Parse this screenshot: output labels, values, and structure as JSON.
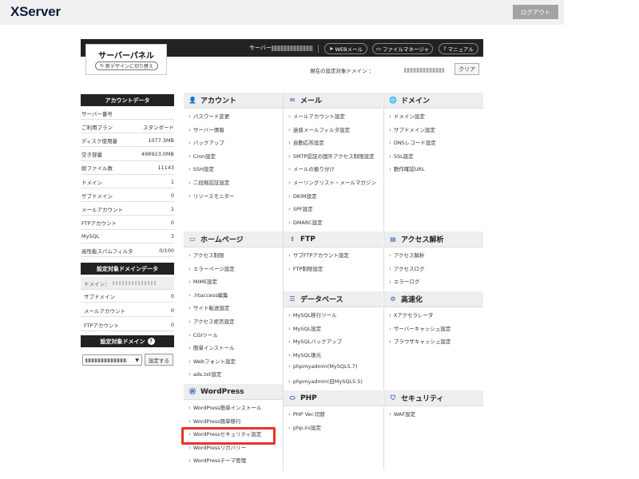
{
  "app": {
    "logo": "XServer",
    "logout": "ログアウト"
  },
  "panel": {
    "title": "サーバーパネル",
    "switch": "新デザインに切り替え"
  },
  "header": {
    "server_id_label": "サーバーID :",
    "webmail": "WEBメール",
    "filemanager": "ファイルマネージャ",
    "manual": "マニュアル",
    "current_domain": "現在の設定対象ドメイン ：",
    "clear": "クリア"
  },
  "account": {
    "title": "アカウントデータ",
    "rows": [
      {
        "label": "サーバー番号",
        "value": ""
      },
      {
        "label": "ご利用プラン",
        "value": "スタンダード"
      },
      {
        "label": "ディスク使用量",
        "value": "1077.3MB"
      },
      {
        "label": "空き容量",
        "value": "498923.0MB"
      },
      {
        "label": "総ファイル数",
        "value": "11143"
      },
      {
        "label": "ドメイン",
        "value": "1"
      },
      {
        "label": "サブドメイン",
        "value": "0"
      },
      {
        "label": "メールアカウント",
        "value": "1"
      },
      {
        "label": "FTPアカウント",
        "value": "0"
      },
      {
        "label": "MySQL",
        "value": "3"
      },
      {
        "label": "高性能スパムフィルタ",
        "value": "0/100"
      }
    ]
  },
  "domain_data": {
    "title": "設定対象ドメインデータ",
    "domain_label": "ドメイン：",
    "rows": [
      {
        "label": "サブドメイン",
        "value": "0"
      },
      {
        "label": "メールアカウント",
        "value": "0"
      },
      {
        "label": "FTPアカウント",
        "value": "0"
      }
    ]
  },
  "domain_select": {
    "title": "設定対象ドメイン",
    "button": "設定する"
  },
  "sections": {
    "account": {
      "title": "アカウント",
      "links": [
        "パスワード変更",
        "サーバー情報",
        "バックアップ",
        "Cron設定",
        "SSH設定",
        "二段階認証設定",
        "リソースモニター"
      ]
    },
    "mail": {
      "title": "メール",
      "links": [
        "メールアカウント設定",
        "迷惑メールフィルタ設定",
        "自動応答設定",
        "SMTP認証の国外アクセス制限設定",
        "メールの振り分け",
        "メーリングリスト・メールマガジン",
        "DKIM設定",
        "SPF設定",
        "DMARC設定"
      ]
    },
    "domain": {
      "title": "ドメイン",
      "links": [
        "ドメイン設定",
        "サブドメイン設定",
        "DNSレコード設定",
        "SSL設定",
        "動作確認URL"
      ]
    },
    "homepage": {
      "title": "ホームページ",
      "links": [
        "アクセス制限",
        "エラーページ設定",
        "MIME設定",
        ".htaccess編集",
        "サイト転送設定",
        "アクセス拒否設定",
        "CGIツール",
        "簡単インストール",
        "Webフォント設定",
        "ads.txt設定"
      ]
    },
    "ftp": {
      "title": "FTP",
      "links": [
        "サブFTPアカウント設定",
        "FTP制限設定"
      ]
    },
    "analytics": {
      "title": "アクセス解析",
      "links": [
        "アクセス解析",
        "アクセスログ",
        "エラーログ"
      ]
    },
    "database": {
      "title": "データベース",
      "links": [
        "MySQL移行ツール",
        "MySQL設定",
        "MySQLバックアップ",
        "MySQL復元",
        "phpmyadmin(MySQL5.7)",
        "phpmyadmin(旧MySQL5.5)"
      ]
    },
    "speed": {
      "title": "高速化",
      "links": [
        "Xアクセラレータ",
        "サーバーキャッシュ設定",
        "ブラウザキャッシュ設定"
      ]
    },
    "wordpress": {
      "title": "WordPress",
      "links": [
        "WordPress簡単インストール",
        "WordPress簡単移行",
        "WordPressセキュリティ設定",
        "WordPressリカバリー",
        "WordPressテーマ管理"
      ]
    },
    "php": {
      "title": "PHP",
      "links": [
        "PHP Ver.切替",
        "php.ini設定"
      ]
    },
    "security": {
      "title": "セキュリティ",
      "links": [
        "WAF設定"
      ]
    }
  },
  "colors": {
    "header_bg": "#222222",
    "highlight": "#e8332a",
    "section_bg": "#eeeeee"
  }
}
